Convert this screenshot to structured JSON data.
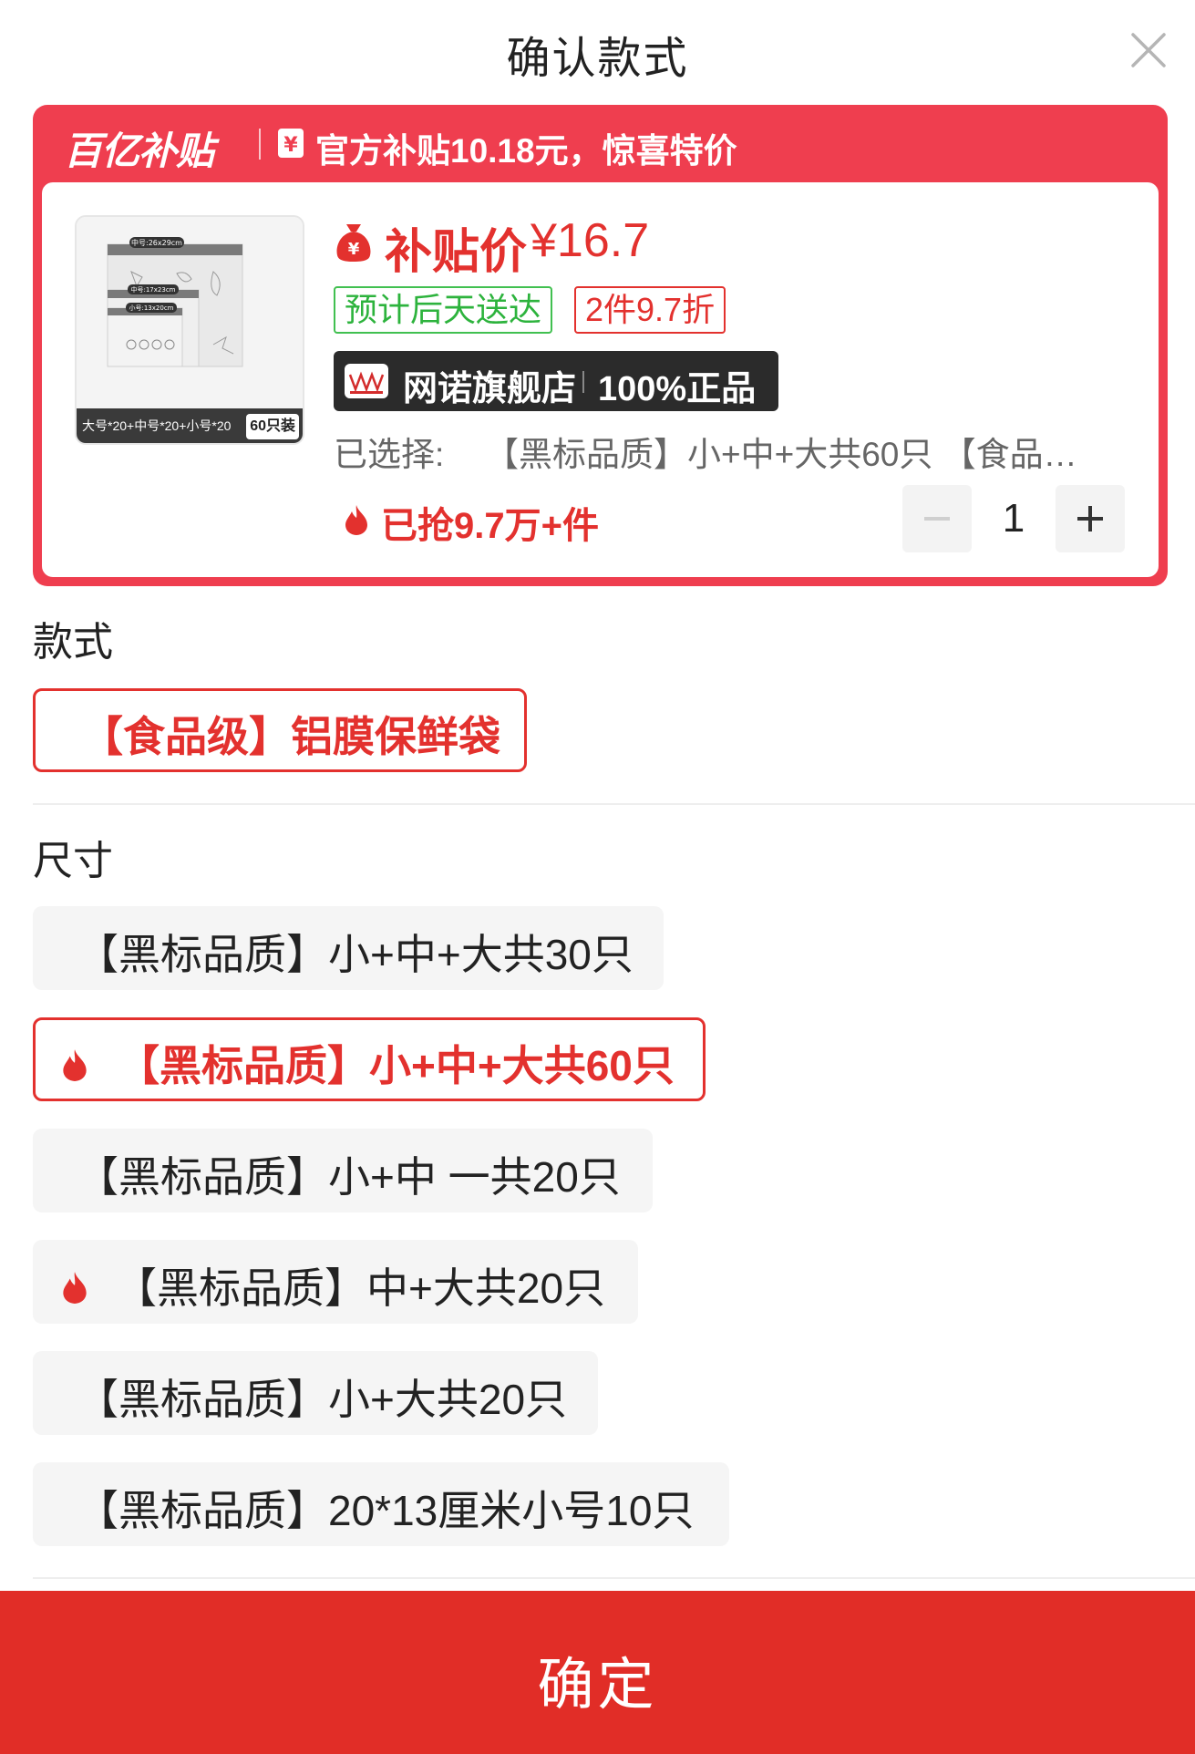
{
  "header": {
    "title": "确认款式"
  },
  "subsidy_bar": {
    "brand": "百亿补贴",
    "text": "官方补贴10.18元，惊喜特价"
  },
  "product": {
    "image_caption": "大号*20+中号*20+小号*20",
    "image_badge": "60只装",
    "image_size_labels": [
      "中号:26x29cm",
      "中号:17x23cm",
      "小号:13x20cm"
    ],
    "price_label": "补贴价",
    "price_value": "¥16.7",
    "tag_delivery": "预计后天送达",
    "tag_discount": "2件9.7折",
    "store_name": "网诺旗舰店",
    "store_guarantee": "100%正品",
    "selected_label": "已选择:",
    "selected_value": "【黑标品质】小+中+大共60只 【食品…",
    "grabbed": "已抢9.7万+件",
    "quantity": "1"
  },
  "style_section": {
    "label": "款式",
    "options": [
      {
        "label": "【食品级】铝膜保鲜袋",
        "selected": true
      }
    ]
  },
  "size_section": {
    "label": "尺寸",
    "options": [
      {
        "label": "【黑标品质】小+中+大共30只",
        "selected": false,
        "hot": false
      },
      {
        "label": "【黑标品质】小+中+大共60只",
        "selected": true,
        "hot": true
      },
      {
        "label": "【黑标品质】小+中 一共20只",
        "selected": false,
        "hot": false
      },
      {
        "label": "【黑标品质】中+大共20只",
        "selected": false,
        "hot": true
      },
      {
        "label": "【黑标品质】小+大共20只",
        "selected": false,
        "hot": false
      },
      {
        "label": "【黑标品质】20*13厘米小号10只",
        "selected": false,
        "hot": false
      }
    ]
  },
  "confirm": {
    "label": "确定"
  },
  "colors": {
    "accent": "#e3312e",
    "card_bg": "#ef3e4f",
    "confirm_bg": "#e12d27",
    "tag_green": "#2db33d"
  },
  "icons": [
    "close-icon",
    "yen-icon",
    "money-bag-icon",
    "store-logo-icon",
    "fire-icon",
    "minus-icon",
    "plus-icon"
  ]
}
